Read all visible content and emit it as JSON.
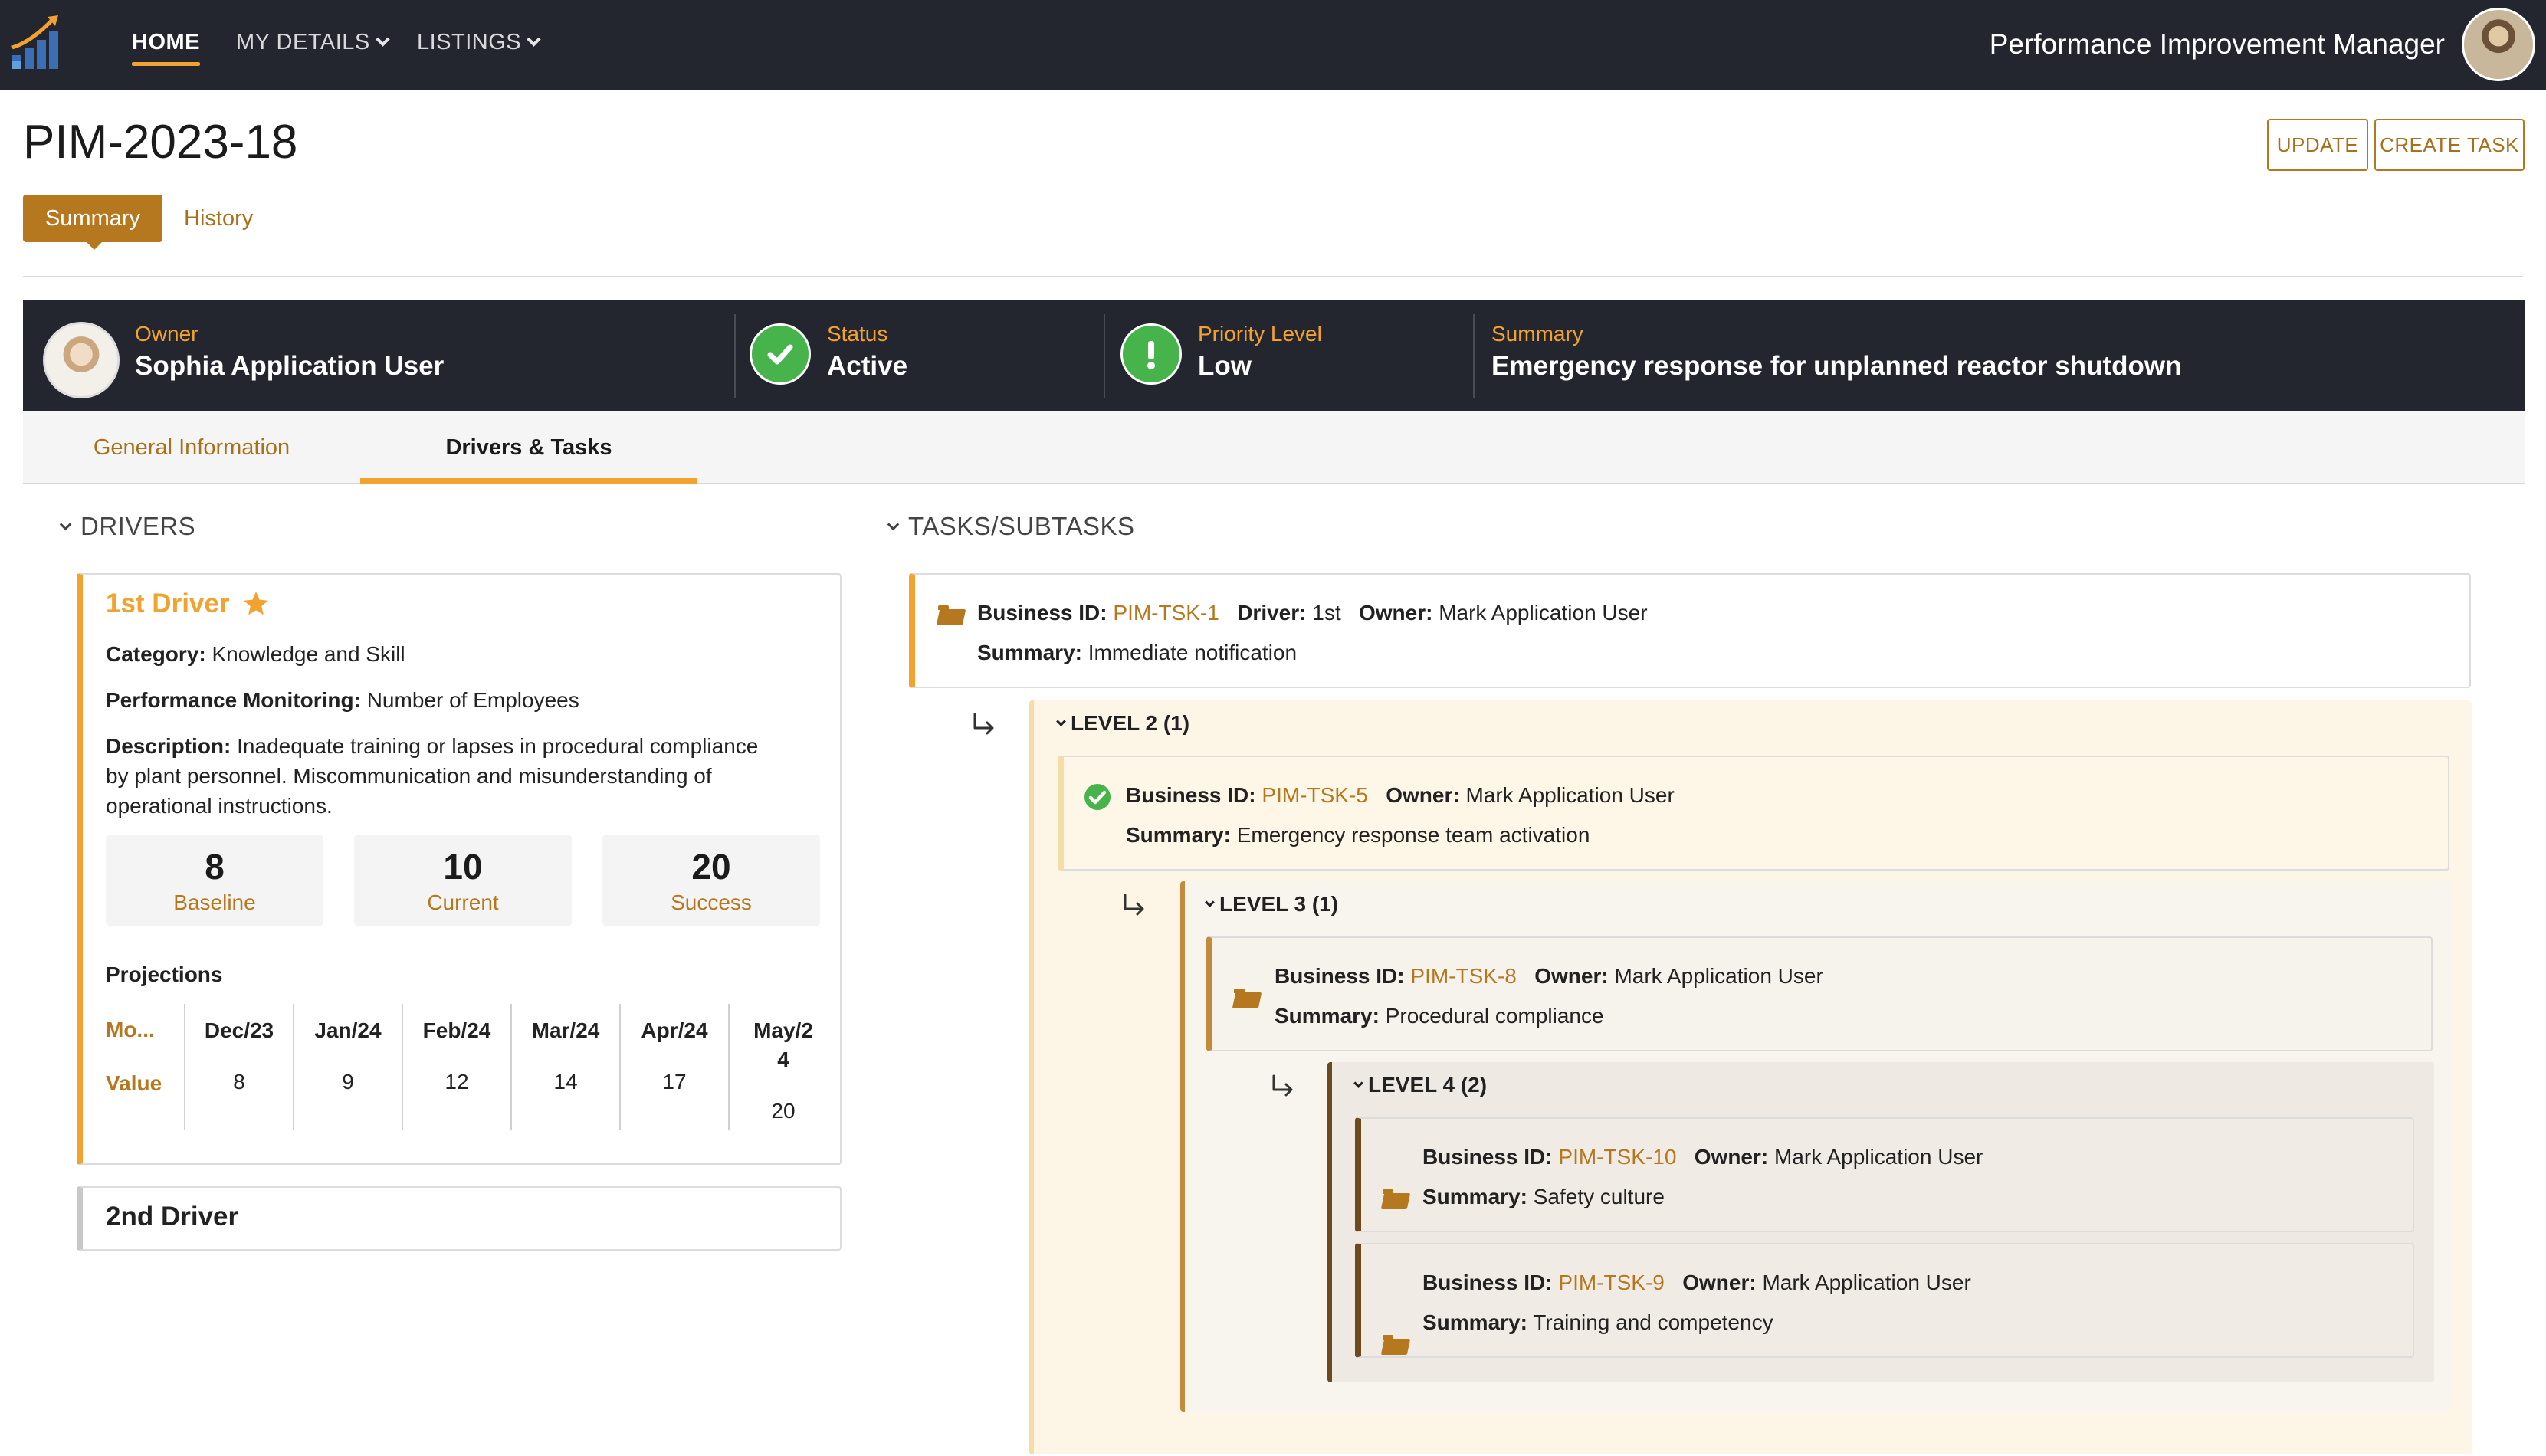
{
  "nav": {
    "home": "HOME",
    "my_details": "MY DETAILS",
    "listings": "LISTINGS",
    "app_title": "Performance Improvement Manager"
  },
  "page": {
    "title": "PIM-2023-18",
    "update_label": "UPDATE",
    "create_task_label": "CREATE TASK",
    "tabs": [
      "Summary",
      "History"
    ]
  },
  "banner": {
    "owner_label": "Owner",
    "owner_value": "Sophia Application User",
    "status_label": "Status",
    "status_value": "Active",
    "priority_label": "Priority Level",
    "priority_value": "Low",
    "summary_label": "Summary",
    "summary_value": "Emergency response for unplanned reactor shutdown"
  },
  "subtabs": [
    "General Information",
    "Drivers & Tasks"
  ],
  "drivers": {
    "heading": "DRIVERS",
    "first": {
      "title": "1st Driver",
      "category_label": "Category:",
      "category_value": "Knowledge and Skill",
      "monitoring_label": "Performance Monitoring:",
      "monitoring_value": "Number of Employees",
      "description_label": "Description:",
      "description_line1": "Inadequate training or lapses in procedural compliance",
      "description_line2": "by plant personnel. Miscommunication and misunderstanding of",
      "description_line3": "operational instructions.",
      "stats": [
        {
          "num": "8",
          "label": "Baseline"
        },
        {
          "num": "10",
          "label": "Current"
        },
        {
          "num": "20",
          "label": "Success"
        }
      ],
      "projections_label": "Projections",
      "proj_row_month": "Mo...",
      "proj_row_value": "Value",
      "projections": [
        {
          "month": "Dec/23",
          "value": "8"
        },
        {
          "month": "Jan/24",
          "value": "9"
        },
        {
          "month": "Feb/24",
          "value": "12"
        },
        {
          "month": "Mar/24",
          "value": "14"
        },
        {
          "month": "Apr/24",
          "value": "17"
        },
        {
          "month_line1": "May/2",
          "month_line2": "4",
          "value": "20"
        }
      ]
    },
    "second": {
      "title": "2nd Driver"
    }
  },
  "tasks": {
    "heading": "TASKS/SUBTASKS",
    "labels": {
      "business_id": "Business ID:",
      "driver": "Driver:",
      "owner": "Owner:",
      "summary": "Summary:"
    },
    "root": {
      "id": "PIM-TSK-1",
      "driver": "1st",
      "owner": "Mark Application User",
      "summary": "Immediate notification"
    },
    "level2": {
      "label": "LEVEL 2 (1)",
      "task": {
        "id": "PIM-TSK-5",
        "owner": "Mark Application User",
        "summary": "Emergency response team activation"
      }
    },
    "level3": {
      "label": "LEVEL 3 (1)",
      "task": {
        "id": "PIM-TSK-8",
        "owner": "Mark Application User",
        "summary": "Procedural compliance"
      }
    },
    "level4": {
      "label": "LEVEL 4 (2)",
      "tasks": [
        {
          "id": "PIM-TSK-10",
          "owner": "Mark Application User",
          "summary": "Safety culture"
        },
        {
          "id": "PIM-TSK-9",
          "owner": "Mark Application User",
          "summary": "Training and competency"
        }
      ]
    }
  },
  "colors": {
    "accent": "#f2a22e",
    "brand_dark": "#24262f",
    "link": "#b5781f",
    "success": "#46b34b"
  }
}
